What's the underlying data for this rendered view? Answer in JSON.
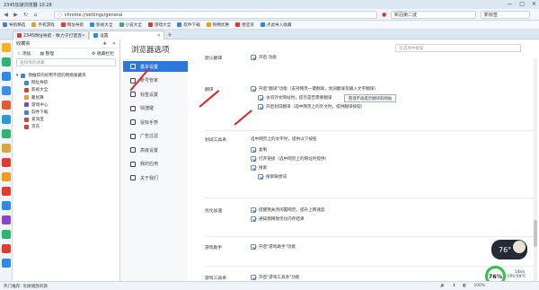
{
  "window": {
    "title": "2345加速浏览器 10.28",
    "controls": [
      "—",
      "□",
      "✕"
    ]
  },
  "address_bar": {
    "url_scheme": "chrome://",
    "url_path": "settings/general",
    "search_engine_icon": "2345-search-icon",
    "search_value": "新冠第二波",
    "user_label": "新标签"
  },
  "bookmarks": [
    {
      "label": "导航精选",
      "color": "#2e8ae6"
    },
    {
      "label": "手机游戏",
      "color": "#f29a1a"
    },
    {
      "label": "网址导航",
      "color": "#e03c31"
    },
    {
      "label": "影视大全",
      "color": "#2e8ae6"
    },
    {
      "label": "小说大全",
      "color": "#2bb673"
    },
    {
      "label": "游戏大全",
      "color": "#e03c31"
    },
    {
      "label": "软件下载",
      "color": "#2e8ae6"
    },
    {
      "label": "购物优惠",
      "color": "#f29a1a"
    },
    {
      "label": "便宜货",
      "color": "#e03c31"
    },
    {
      "label": "点此导入收藏",
      "color": "#2e8ae6"
    }
  ],
  "tabs": [
    {
      "label": "2345网址导航 - 致力于打造百",
      "color": "#e03c31"
    },
    {
      "label": "设置",
      "color": "#2e8ae6"
    }
  ],
  "favorites_panel": {
    "title": "收藏夹",
    "add_label": "添加",
    "manage_label": "整理",
    "bar_toggle_label": "收藏栏栏",
    "search_placeholder": "查找我的收藏",
    "root_label": "我推荐的好用不错的网络收藏夹",
    "items": [
      {
        "label": "网址导航",
        "color": "#2e8ae6"
      },
      {
        "label": "影视大全",
        "color": "#e03c31"
      },
      {
        "label": "聚划算",
        "color": "#f29a1a"
      },
      {
        "label": "游戏中心",
        "color": "#8b45c9"
      },
      {
        "label": "软件下载",
        "color": "#2e8ae6"
      },
      {
        "label": "爱淘宝",
        "color": "#e03c31"
      },
      {
        "label": "京东",
        "color": "#e03c31"
      }
    ]
  },
  "settings": {
    "page_title": "浏览器选项",
    "search_placeholder": "在选项中搜索",
    "nav": [
      {
        "label": "基本设置",
        "active": true
      },
      {
        "label": "账号管家",
        "active": false
      },
      {
        "label": "标签设置",
        "active": false
      },
      {
        "label": "快捷键",
        "active": false
      },
      {
        "label": "鼠标手势",
        "active": false
      },
      {
        "label": "广告过滤",
        "active": false
      },
      {
        "label": "高级设置",
        "active": false
      },
      {
        "label": "我的应用",
        "active": false
      },
      {
        "label": "关于我们",
        "active": false
      }
    ],
    "sections": {
      "top_cut": {
        "label": "默认翻译",
        "option": "开启 功能"
      },
      "translate": {
        "label": "翻译",
        "option1": "开启\"翻译\"功能（支持网页一键翻译，划词翻译及输入文字翻译）",
        "option2": "访问外文网站时，提示是否需要翻译",
        "manage_button": "管理不再提示翻译的网站",
        "option3": "开启划词翻译（选中网页上的外文时，提供翻译按钮）"
      },
      "word_tool": {
        "label": "划词工具条",
        "desc": "选中网页上的文字时，提供以下按钮",
        "copy": "复制",
        "open_link": "打开链接（选中网页上的网址时提供）",
        "search": "搜索",
        "search_sub": "搜索联想词"
      },
      "optimize": {
        "label": "优化加速",
        "option1": "提醒我关闭闲置网页，提升上网速度",
        "option2": "通知我释放优化内存结果"
      },
      "game_helper": {
        "label": "游戏助手",
        "option": "开启\"游戏助手\"功能"
      },
      "game_toolbar": {
        "label": "游戏工具条",
        "option": "开启\"游戏工具条\"功能"
      }
    }
  },
  "widgets": {
    "gauge_value": "76°",
    "ring_value": "76%",
    "cpu_label": "CPU 59°C",
    "net_label": "14k/s"
  },
  "status_bar": {
    "left_text": "热门推荐: 优质播放的歌",
    "right_items": [
      "🔊",
      "⬇",
      "◧",
      "100%"
    ]
  }
}
